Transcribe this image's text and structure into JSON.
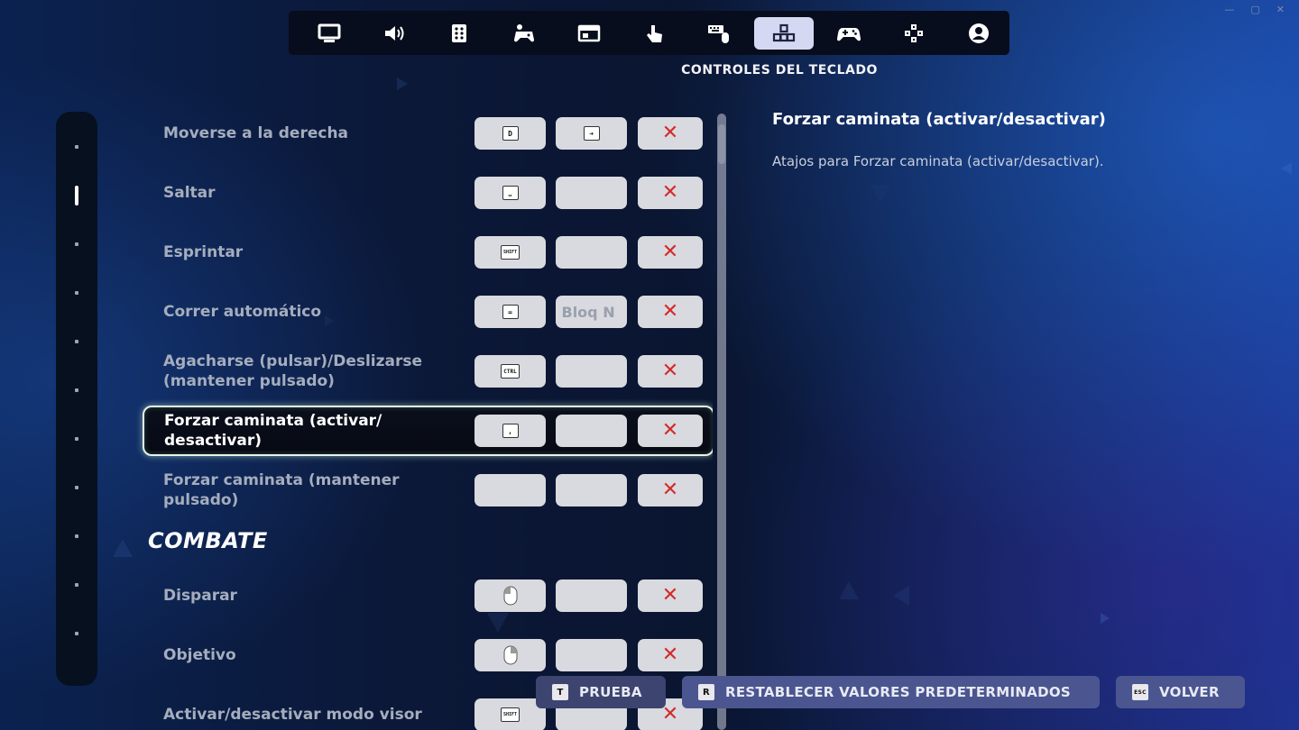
{
  "window": {
    "minimize": "—",
    "maximize": "▢",
    "close": "✕"
  },
  "topbar": {
    "tabs": [
      {
        "icon": "monitor-icon"
      },
      {
        "icon": "speaker-icon"
      },
      {
        "icon": "grid-dots-icon"
      },
      {
        "icon": "controller-accessibility-icon"
      },
      {
        "icon": "hud-window-icon"
      },
      {
        "icon": "touch-hand-icon"
      },
      {
        "icon": "keyboard-mouse-icon"
      },
      {
        "icon": "keyboard-controls-icon",
        "active": true
      },
      {
        "icon": "gamepad-icon"
      },
      {
        "icon": "controller-settings-icon"
      },
      {
        "icon": "account-icon"
      }
    ],
    "section_title": "CONTROLES DEL TECLADO"
  },
  "list": {
    "rows": [
      {
        "label": "Moverse a la derecha",
        "key1": "D",
        "key2": "➜"
      },
      {
        "label": "Saltar",
        "key1": "⎵",
        "key2": ""
      },
      {
        "label": "Esprintar",
        "key1": "SHIFT",
        "key2": ""
      },
      {
        "label": "Correr automático",
        "key1": "=",
        "key2_text": "Bloq N"
      },
      {
        "label": "Agacharse (pulsar)/Deslizarse (mantener pulsado)",
        "key1": "CTRL",
        "key2": ""
      },
      {
        "label": "Forzar caminata (activar/ desactivar)",
        "key1": ",",
        "key2": "",
        "selected": true
      },
      {
        "label": "Forzar caminata (mantener pulsado)",
        "key1": "",
        "key2": ""
      }
    ],
    "combat_heading": "COMBATE",
    "combat_rows": [
      {
        "label": "Disparar",
        "key1": "mouse-left-icon"
      },
      {
        "label": "Objetivo",
        "key1": "mouse-right-icon"
      },
      {
        "label": "Activar/desactivar modo visor",
        "key1": "SHIFT"
      }
    ],
    "clear_symbol": "✕"
  },
  "detail": {
    "title": "Forzar caminata (activar/desactivar)",
    "description": "Atajos para Forzar caminata (activar/desactivar)."
  },
  "footer": {
    "prueba": {
      "key": "T",
      "label": "PRUEBA"
    },
    "reset": {
      "key": "R",
      "label": "RESTABLECER VALORES PREDETERMINADOS"
    },
    "volver": {
      "key": "ESC",
      "label": "VOLVER"
    }
  },
  "colors": {
    "accent_active_tab": "#d5d8f2",
    "clear_red": "#d22c2c",
    "footer_button": "#4b5690"
  }
}
